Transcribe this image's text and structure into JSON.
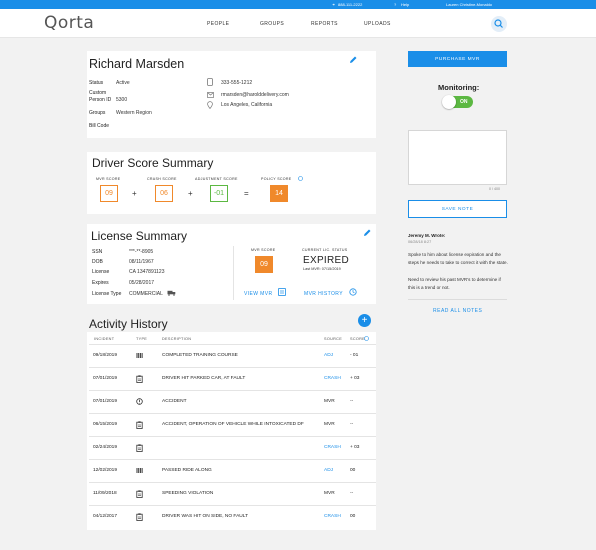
{
  "topbar": {
    "phone": "888-111-2222",
    "help": "Help",
    "user": "Lauren Christine-Monaldo"
  },
  "brand": {
    "logo": "Qorta"
  },
  "nav": [
    "PEOPLE",
    "GROUPS",
    "REPORTS",
    "UPLOADS"
  ],
  "profile": {
    "name": "Richard Marsden",
    "status_label": "Status",
    "status": "Active",
    "custom_id_label_1": "Custom",
    "custom_id_label_2": "Person ID",
    "custom_id": "5300",
    "groups_label": "Groups",
    "groups": "Western Region",
    "bill_code_label": "Bill Code",
    "phone": "333-555-1212",
    "email": "rmarsden@harolddelivery.com",
    "location": "Los Angeles, California"
  },
  "driver_score": {
    "title": "Driver Score Summary",
    "mvr_label": "MVR SCORE",
    "mvr": "09",
    "crash_label": "CRASH SCORE",
    "crash": "06",
    "adj_label": "ADJUSTMENT SCORE",
    "adj": "-01",
    "policy_label": "POLICY SCORE",
    "policy": "14",
    "plus": "+",
    "equals": "="
  },
  "license": {
    "title": "License Summary",
    "ssn_label": "SSN",
    "ssn": "***-**-8905",
    "dob_label": "DOB",
    "dob": "08/11/1967",
    "license_label": "License",
    "license": "CA  1347891123",
    "expires_label": "Expires",
    "expires": "05/28/2017",
    "type_label": "License Type",
    "type": "COMMERCIAL",
    "mvr_score_label": "MVR SCORE",
    "mvr_score": "09",
    "status_label": "CURRENT LIC. STATUS",
    "status": "EXPIRED",
    "last_mvr": "Last MVR: 07/15/2019",
    "view_mvr": "VIEW MVR",
    "mvr_history": "MVR HISTORY"
  },
  "activity": {
    "title": "Activity History",
    "headers": {
      "incident": "INCIDENT",
      "type": "TYPE",
      "description": "DESCRIPTION",
      "source": "SOURCE",
      "score": "SCORE"
    },
    "rows": [
      {
        "date": "09/18/2019",
        "icon": "training-icon",
        "desc": "COMPLETED TRAINING COURSE",
        "source": "ADJ",
        "source_link": true,
        "score": "- 01"
      },
      {
        "date": "07/01/2019",
        "icon": "clipboard-icon",
        "desc": "DRIVER HIT PARKED CAR, AT FAULT",
        "source": "CRASH",
        "source_link": true,
        "score": "+ 03"
      },
      {
        "date": "07/01/2019",
        "icon": "alert-icon",
        "desc": "ACCIDENT",
        "source": "MVR",
        "source_link": false,
        "score": "--"
      },
      {
        "date": "06/15/2019",
        "icon": "clipboard-icon",
        "desc": "ACCIDENT, OPERATION OF VEHICLE WHILE INTOXICATED DF",
        "source": "MVR",
        "source_link": false,
        "score": "--"
      },
      {
        "date": "02/24/2019",
        "icon": "clipboard-icon",
        "desc": "",
        "source": "CRASH",
        "source_link": true,
        "score": "+ 03"
      },
      {
        "date": "12/02/2019",
        "icon": "training-icon",
        "desc": "PASSED RIDE ALONG",
        "source": "ADJ",
        "source_link": true,
        "score": "00"
      },
      {
        "date": "11/09/2018",
        "icon": "clipboard-icon",
        "desc": "SPEEDING VIOLATION",
        "source": "MVR",
        "source_link": false,
        "score": "--"
      },
      {
        "date": "04/12/2017",
        "icon": "clipboard-icon",
        "desc": "DRIVER WAS HIT ON SIDE, NO FAULT",
        "source": "CRASH",
        "source_link": true,
        "score": "00"
      }
    ]
  },
  "sidebar": {
    "purchase_mvr": "PURCHASE MVR",
    "monitoring_label": "Monitoring:",
    "toggle": "ON",
    "char_count": "0 / 400",
    "save_note": "SAVE NOTE",
    "note_author": "Jeremy M. Wrote:",
    "note_date": "06/28/18 8:27",
    "note_p1": "Spoke to him about license expiration and the steps he needs to take to correct it with the state.",
    "note_p2": "Need to review his past MVR's to determine if this is a trend or not.",
    "read_all": "READ ALL NOTES"
  },
  "colors": {
    "accent": "#1a8ee8",
    "orange": "#f0892b",
    "green": "#5cb842"
  }
}
